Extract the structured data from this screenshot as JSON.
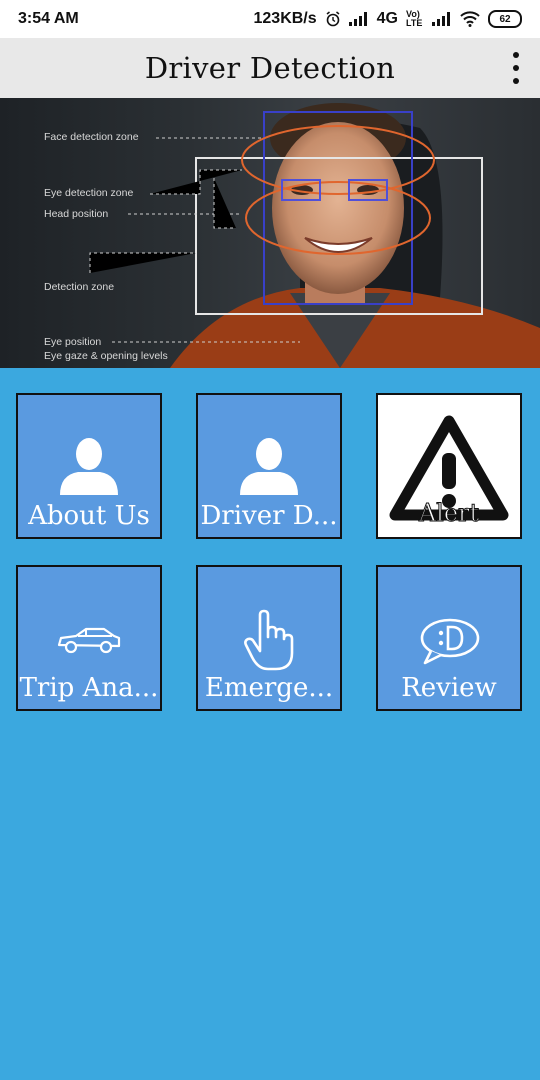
{
  "status_bar": {
    "time": "3:54 AM",
    "network_speed": "123KB/s",
    "network_type": "4G",
    "volte": "Vo) LTE",
    "battery": "62"
  },
  "app_bar": {
    "title": "Driver Detection",
    "menu_icon": "more-vert-icon"
  },
  "banner": {
    "annotations": {
      "face": "Face detection zone",
      "eye": "Eye detection zone",
      "head": "Head position",
      "detection": "Detection zone",
      "eye_position": "Eye position",
      "eye_gaze": "Eye gaze & opening levels"
    }
  },
  "tiles": [
    {
      "label": "About Us",
      "icon": "person-icon"
    },
    {
      "label": "Driver D...",
      "icon": "person-icon"
    },
    {
      "label": "Alert",
      "icon": "warning-icon"
    },
    {
      "label": "Trip Ana...",
      "icon": "car-icon"
    },
    {
      "label": "Emerge...",
      "icon": "touch-hand-icon"
    },
    {
      "label": "Review",
      "icon": "chat-smile-icon"
    }
  ],
  "colors": {
    "background": "#3ba8df",
    "tile": "#5a9ae0",
    "app_bar": "#e8e8e8"
  }
}
